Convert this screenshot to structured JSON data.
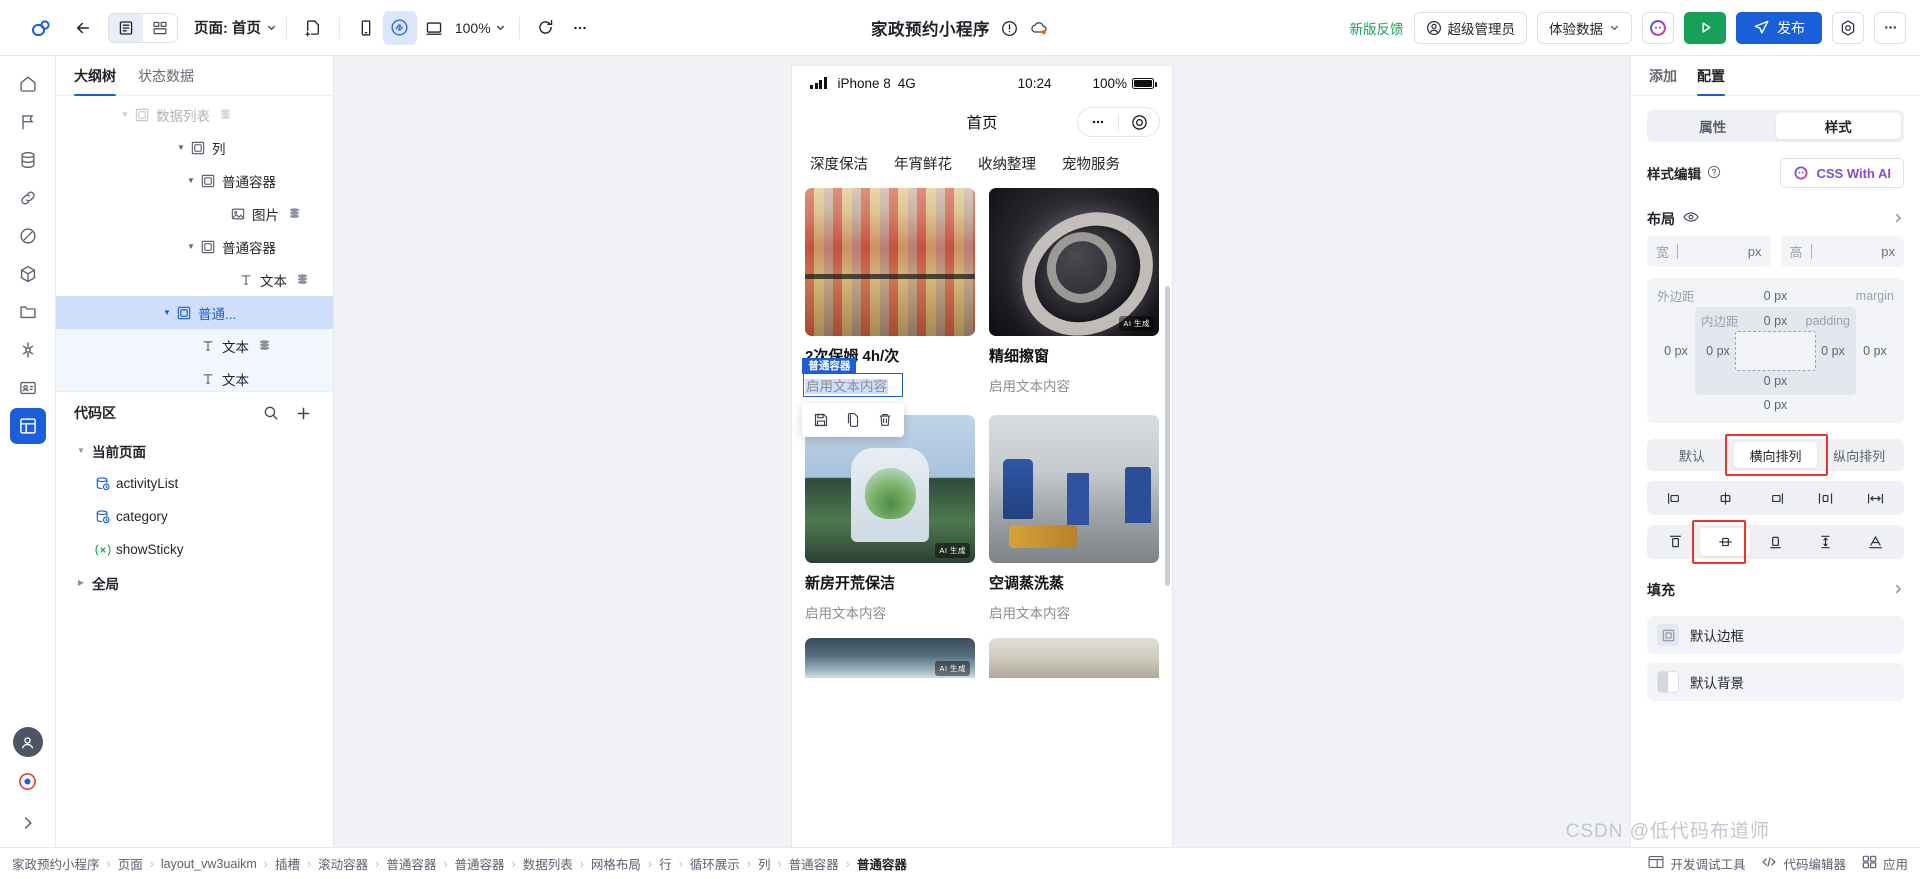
{
  "topbar": {
    "back_title": "返回",
    "view_outline": "大纲视图",
    "view_grid": "组件视图",
    "page_label": "页面: 首页",
    "new_page": "新建页面",
    "device_mobile": "手机",
    "device_mini": "小程序",
    "device_desktop": "桌面",
    "zoom": "100%",
    "refresh": "刷新",
    "more": "…",
    "app_title": "家政预约小程序",
    "feedback": "新版反馈",
    "role": "超级管理员",
    "experience_data": "体验数据",
    "publish": "发布",
    "settings": "设置",
    "more_right": "…"
  },
  "left": {
    "tabs": [
      {
        "label": "大纲树",
        "active": true
      },
      {
        "label": "状态数据",
        "active": false
      }
    ],
    "tree": [
      {
        "label": "数据列表",
        "indent": 3,
        "caret": "down",
        "icon": "container-icon",
        "db": true,
        "state": "cut"
      },
      {
        "label": "列",
        "indent": 4,
        "caret": "down",
        "icon": "container-icon",
        "db": false,
        "state": ""
      },
      {
        "label": "普通容器",
        "indent": 5,
        "caret": "down",
        "icon": "container-icon",
        "db": false,
        "state": ""
      },
      {
        "label": "图片",
        "indent": 6,
        "caret": "none",
        "icon": "image-icon",
        "db": true,
        "state": ""
      },
      {
        "label": "普通容器",
        "indent": 5,
        "caret": "down",
        "icon": "container-icon",
        "db": false,
        "state": ""
      },
      {
        "label": "文本",
        "indent": 6,
        "caret": "none",
        "icon": "text-icon",
        "db": true,
        "state": ""
      },
      {
        "label": "普通...",
        "indent": 6,
        "caret": "down",
        "icon": "container-icon",
        "db": false,
        "state": "selected"
      },
      {
        "label": "文本",
        "indent": 7,
        "caret": "none",
        "icon": "text-icon",
        "db": true,
        "state": "child"
      },
      {
        "label": "文本",
        "indent": 7,
        "caret": "none",
        "icon": "text-icon",
        "db": false,
        "state": "child"
      }
    ],
    "code": {
      "title": "代码区",
      "search": "搜索",
      "add": "新增",
      "groups": [
        {
          "label": "当前页面",
          "caret": "down",
          "type": "group"
        },
        {
          "label": "activityList",
          "caret": "none",
          "type": "model"
        },
        {
          "label": "category",
          "caret": "none",
          "type": "model"
        },
        {
          "label": "showSticky",
          "caret": "none",
          "type": "var"
        },
        {
          "label": "全局",
          "caret": "right",
          "type": "group"
        }
      ]
    }
  },
  "phone": {
    "status": {
      "device": "iPhone 8",
      "network": "4G",
      "time": "10:24",
      "battery": "100%"
    },
    "nav_title": "首页",
    "categories": [
      "深度保洁",
      "年宵鲜花",
      "收纳整理",
      "宠物服务"
    ],
    "cards": [
      {
        "title": "2次保姆  4h/次",
        "sub": "启用文本内容",
        "art": "art1",
        "ai": false,
        "selected": true,
        "badge": "普通容器"
      },
      {
        "title": "精细擦窗",
        "sub": "启用文本内容",
        "art": "art2",
        "ai": true
      },
      {
        "title": "新房开荒保洁",
        "sub": "启用文本内容",
        "art": "art3",
        "ai": true
      },
      {
        "title": "空调蒸洗蒸",
        "sub": "启用文本内容",
        "art": "art4",
        "ai": false
      },
      {
        "title": "",
        "sub": "",
        "art": "art5",
        "ai": true
      },
      {
        "title": "",
        "sub": "",
        "art": "art6",
        "ai": false
      }
    ],
    "sel_tools": [
      {
        "name": "save-icon",
        "title": "保存"
      },
      {
        "name": "copy-icon",
        "title": "复制"
      },
      {
        "name": "delete-icon",
        "title": "删除"
      }
    ]
  },
  "right": {
    "tabs": [
      {
        "label": "添加",
        "active": false
      },
      {
        "label": "配置",
        "active": true
      }
    ],
    "switch": [
      {
        "label": "属性",
        "active": false
      },
      {
        "label": "样式",
        "active": true
      }
    ],
    "style_edit_label": "样式编辑",
    "css_ai": "CSS With AI",
    "layout": {
      "title": "布局",
      "width_label": "宽",
      "width_value": "",
      "height_label": "高",
      "height_value": "",
      "unit": "px",
      "margin_label": "外边距",
      "margin_en": "margin",
      "margin_top": "0 px",
      "margin_right": "0 px",
      "margin_bottom": "0 px",
      "margin_left": "0 px",
      "padding_label": "内边距",
      "padding_en": "padding",
      "padding_top": "0 px",
      "padding_right": "0 px",
      "padding_bottom": "0 px",
      "padding_left": "0 px"
    },
    "direction": [
      {
        "label": "默认",
        "active": false,
        "highlight": false
      },
      {
        "label": "横向排列",
        "active": true,
        "highlight": true
      },
      {
        "label": "纵向排列",
        "active": false,
        "highlight": false
      }
    ],
    "justify_icons": [
      {
        "name": "align-left-icon",
        "active": false
      },
      {
        "name": "align-center-icon",
        "active": false
      },
      {
        "name": "align-right-icon",
        "active": false
      },
      {
        "name": "align-stretch-icon",
        "active": false
      },
      {
        "name": "align-space-between-icon",
        "active": false
      }
    ],
    "align_icons": [
      {
        "name": "align-top-icon",
        "active": false,
        "highlight": false
      },
      {
        "name": "align-middle-icon",
        "active": true,
        "highlight": true
      },
      {
        "name": "align-bottom-icon",
        "active": false,
        "highlight": false
      },
      {
        "name": "align-vstretch-icon",
        "active": false,
        "highlight": false
      },
      {
        "name": "align-baseline-icon",
        "active": false,
        "highlight": false
      }
    ],
    "fill": {
      "title": "填充",
      "items": [
        {
          "label": "默认边框",
          "swatch": "#e4e8ee",
          "type": "border"
        },
        {
          "label": "默认背景",
          "swatch": "#dfe3e9",
          "type": "background"
        }
      ]
    }
  },
  "bottom": {
    "breadcrumb": [
      "家政预约小程序",
      "页面",
      "layout_vw3uaikm",
      "插槽",
      "滚动容器",
      "普通容器",
      "普通容器",
      "数据列表",
      "网格布局",
      "行",
      "循环展示",
      "列",
      "普通容器",
      "普通容器"
    ],
    "right_items": [
      {
        "label": "开发调试工具",
        "icon": "devtools-icon"
      },
      {
        "label": "代码编辑器",
        "icon": "code-icon"
      },
      {
        "label": "应用",
        "icon": "apps-icon"
      }
    ],
    "watermark": "CSDN @低代码布道师"
  },
  "colors": {
    "accent": "#1a5fd8",
    "green": "#18a058",
    "red_highlight": "#e8352b",
    "selection_bg": "#cfdefa"
  }
}
